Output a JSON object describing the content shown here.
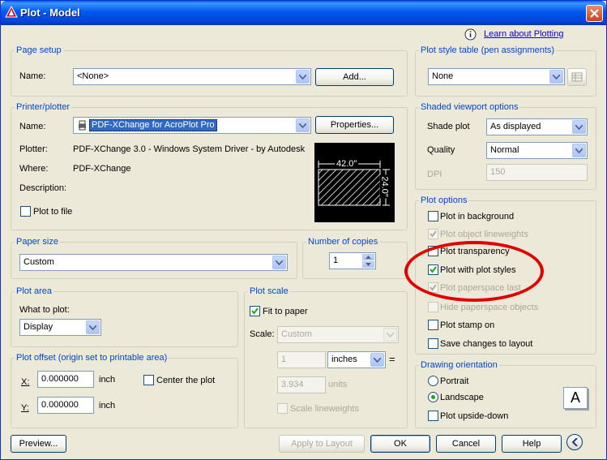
{
  "window": {
    "title": "Plot - Model"
  },
  "help_link": "Learn about Plotting",
  "page_setup": {
    "legend": "Page setup",
    "name_label": "Name:",
    "name_value": "<None>",
    "add_label": "Add..."
  },
  "printer": {
    "legend": "Printer/plotter",
    "name_label": "Name:",
    "name_value": "PDF-XChange for AcroPlot Pro",
    "properties_label": "Properties...",
    "plotter_label": "Plotter:",
    "plotter_value": "PDF-XChange 3.0 - Windows System Driver - by Autodesk",
    "where_label": "Where:",
    "where_value": "PDF-XChange",
    "description_label": "Description:",
    "plot_to_file_label": "Plot to file",
    "preview_width": "42.0″",
    "preview_height": "24.0″"
  },
  "paper_size": {
    "legend": "Paper size",
    "value": "Custom"
  },
  "copies": {
    "legend": "Number of copies",
    "value": "1"
  },
  "plot_area": {
    "legend": "Plot area",
    "what_label": "What to plot:",
    "value": "Display"
  },
  "plot_offset": {
    "legend": "Plot offset (origin set to printable area)",
    "x_label": "X:",
    "x_value": "0.000000",
    "x_unit": "inch",
    "y_label": "Y:",
    "y_value": "0.000000",
    "y_unit": "inch",
    "center_label": "Center the plot"
  },
  "plot_scale": {
    "legend": "Plot scale",
    "fit_label": "Fit to paper",
    "scale_label": "Scale:",
    "scale_value": "Custom",
    "num_value": "1",
    "unit_value": "inches",
    "equals": "=",
    "den_value": "3.934",
    "den_unit": "units",
    "lineweights_label": "Scale lineweights"
  },
  "plot_style_table": {
    "legend": "Plot style table (pen assignments)",
    "value": "None"
  },
  "shaded_viewport": {
    "legend": "Shaded viewport options",
    "shade_label": "Shade plot",
    "shade_value": "As displayed",
    "quality_label": "Quality",
    "quality_value": "Normal",
    "dpi_label": "DPI",
    "dpi_value": "150"
  },
  "plot_options": {
    "legend": "Plot options",
    "items": [
      {
        "label": "Plot in background",
        "checked": false,
        "enabled": true
      },
      {
        "label": "Plot object lineweights",
        "checked": true,
        "enabled": false
      },
      {
        "label": "Plot transparency",
        "checked": false,
        "enabled": true
      },
      {
        "label": "Plot with plot styles",
        "checked": true,
        "enabled": true
      },
      {
        "label": "Plot paperspace last",
        "checked": true,
        "enabled": false
      },
      {
        "label": "Hide paperspace objects",
        "checked": false,
        "enabled": false
      },
      {
        "label": "Plot stamp on",
        "checked": false,
        "enabled": true
      },
      {
        "label": "Save changes to layout",
        "checked": false,
        "enabled": true
      }
    ]
  },
  "orientation": {
    "legend": "Drawing orientation",
    "portrait_label": "Portrait",
    "landscape_label": "Landscape",
    "upside_label": "Plot upside-down",
    "icon_letter": "A"
  },
  "footer": {
    "preview_label": "Preview...",
    "apply_label": "Apply to Layout",
    "ok_label": "OK",
    "cancel_label": "Cancel",
    "help_label": "Help"
  },
  "colors": {
    "accent": "#0046d5",
    "highlight": "#e00000",
    "title_bar": "#0058ee"
  }
}
